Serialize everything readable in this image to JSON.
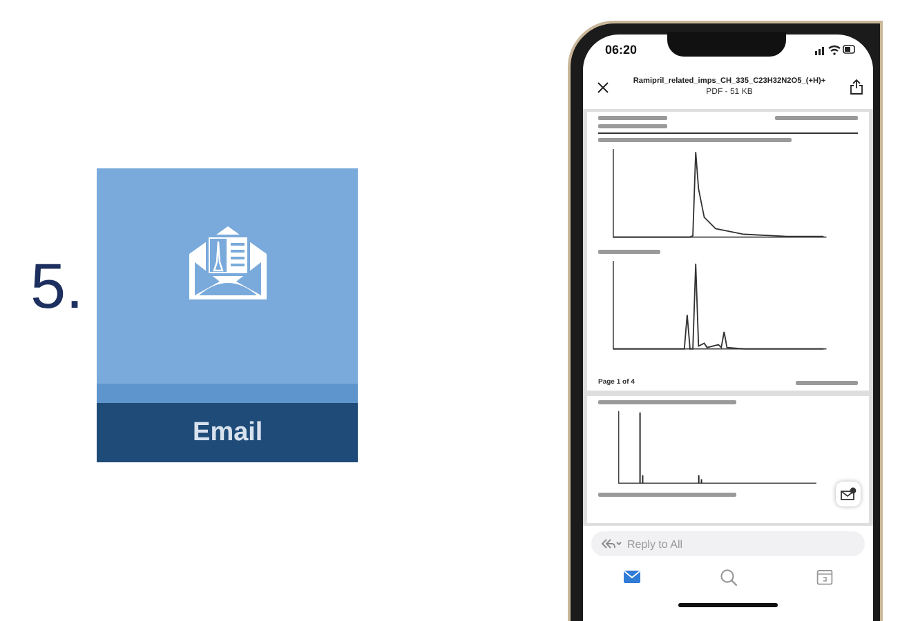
{
  "step": {
    "number": "5."
  },
  "tile": {
    "label": "Email"
  },
  "phone": {
    "status_bar": {
      "time": "06:20"
    },
    "header": {
      "title": "Ramipril_related_imps_CH_335_C23H32N2O5_(+H)+",
      "subtitle": "PDF - 51 KB"
    },
    "document": {
      "footer": "Page 1 of 4"
    },
    "reply_bar": {
      "placeholder": "Reply to All"
    },
    "tab_bar": {
      "tabs": [
        {
          "kind": "mail",
          "selected": true
        },
        {
          "kind": "search",
          "selected": false
        },
        {
          "kind": "calendar",
          "selected": false
        }
      ]
    }
  }
}
